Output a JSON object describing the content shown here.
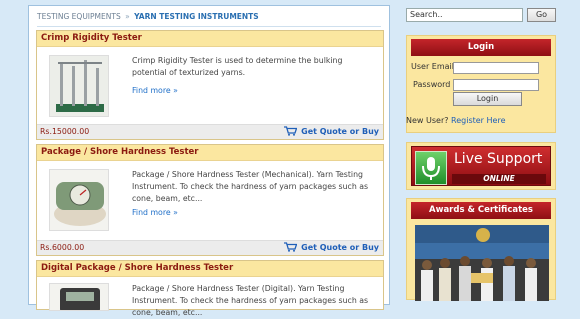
{
  "breadcrumb": {
    "parent": "TESTING EQUIPMENTS",
    "separator": "»",
    "current": "YARN TESTING INSTRUMENTS"
  },
  "products": [
    {
      "title": "Crimp Rigidity Tester",
      "description": "Crimp Rigidity Tester is used to determine the bulking potential of texturized yarns.",
      "find_more": "Find more »",
      "price": "Rs.15000.00",
      "quote": "Get Quote or Buy"
    },
    {
      "title": "Package / Shore Hardness Tester",
      "description": "Package / Shore Hardness Tester (Mechanical). Yarn Testing Instrument. To check the hardness of yarn packages such as cone, beam, etc...",
      "find_more": "Find more »",
      "price": "Rs.6000.00",
      "quote": "Get Quote or Buy"
    },
    {
      "title": "Digital Package / Shore Hardness Tester",
      "description": "Package / Shore Hardness Tester (Digital). Yarn Testing Instrument. To check the hardness of yarn packages such as cone, beam, etc..."
    }
  ],
  "search": {
    "placeholder": "Search..",
    "button": "Go"
  },
  "login": {
    "title": "Login",
    "email_label": "User Email",
    "password_label": "Password",
    "button": "Login",
    "new_user": "New User?",
    "register": "Register Here"
  },
  "support": {
    "title": "Live Support",
    "status": "ONLINE"
  },
  "awards": {
    "title": "Awards & Certificates"
  },
  "colors": {
    "page_bg": "#d7e9f7",
    "title_bar": "#fbe7a0",
    "title_text": "#8b1a10",
    "link": "#1f5fb8",
    "panel_red": "#b01c22"
  }
}
